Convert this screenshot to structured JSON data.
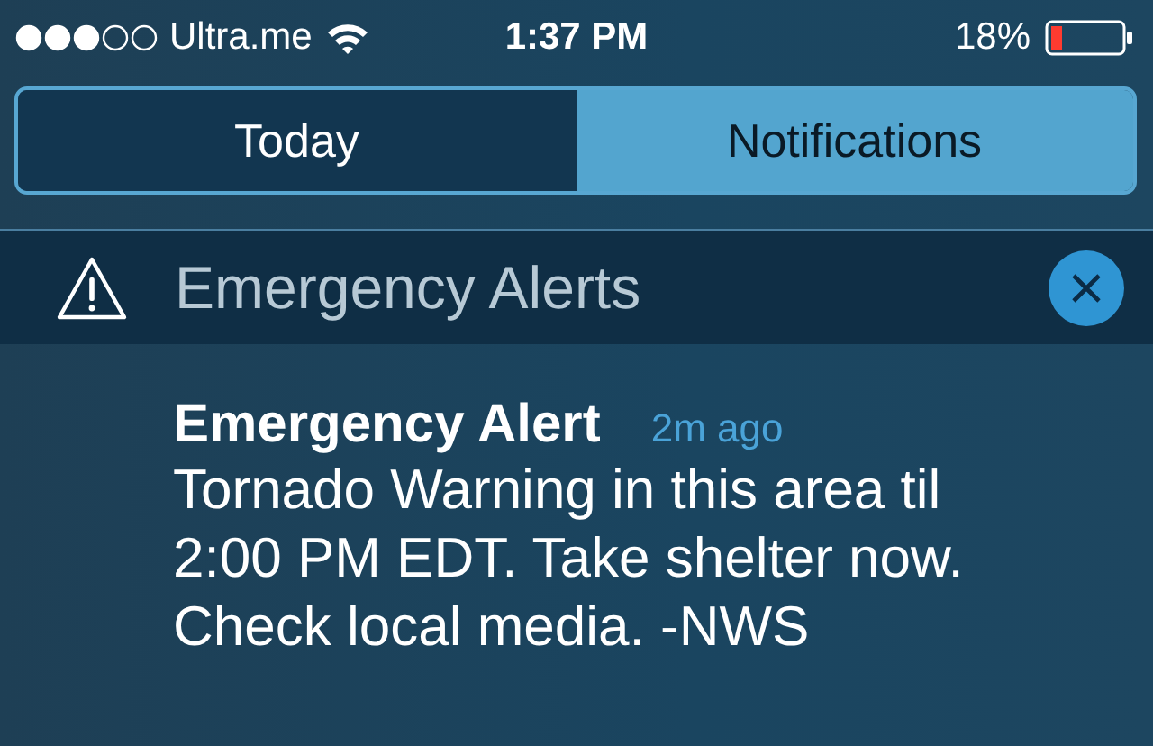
{
  "status_bar": {
    "carrier": "Ultra.me",
    "time": "1:37 PM",
    "battery": "18%"
  },
  "tabs": [
    {
      "label": "Today",
      "selected": false
    },
    {
      "label": "Notifications",
      "selected": true
    }
  ],
  "section": {
    "title": "Emergency Alerts"
  },
  "notification": {
    "title": "Emergency Alert",
    "time": "2m ago",
    "body": "Tornado Warning in this area til 2:00 PM EDT. Take shelter now. Check local media. -NWS"
  }
}
